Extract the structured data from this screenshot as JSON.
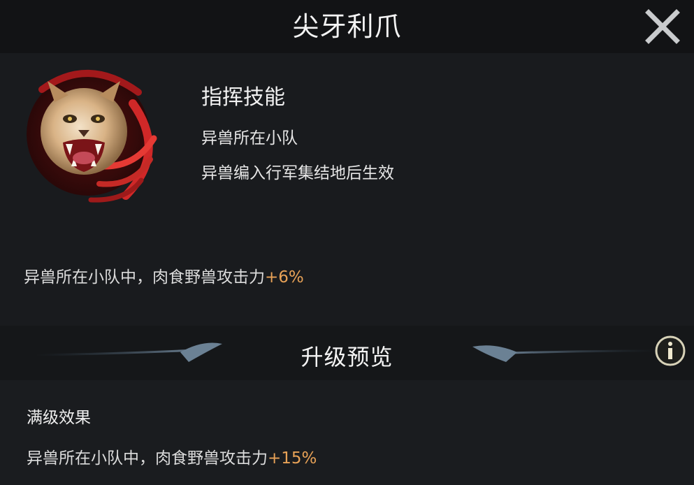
{
  "header": {
    "title": "尖牙利爪",
    "close_icon": "close-icon"
  },
  "skill": {
    "type": "指挥技能",
    "condition_scope": "异兽所在小队",
    "condition_activation": "异兽编入行军集结地后生效",
    "icon": "snarling-wildcat-emblem",
    "current_effect": {
      "prefix": "异兽所在小队中，肉食野兽攻击力",
      "value": "+6%"
    }
  },
  "upgrade_preview": {
    "title": "升级预览",
    "info_icon": "info-icon",
    "max_level_label": "满级效果",
    "max_effect": {
      "prefix": "异兽所在小队中，肉食野兽攻击力",
      "value": "+15%"
    }
  },
  "colors": {
    "highlight": "#e8a257",
    "background": "#191b1e",
    "emblem_red": "#b3181c"
  }
}
